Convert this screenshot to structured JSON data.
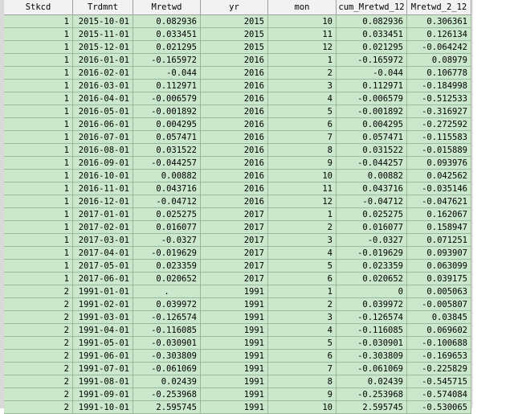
{
  "columns": [
    "Stkcd",
    "Trdmnt",
    "Mretwd",
    "yr",
    "mon",
    "cum_Mretwd_12",
    "Mretwd_2_12"
  ],
  "rows": [
    [
      "1",
      "2015-10-01",
      "0.082936",
      "2015",
      "10",
      "0.082936",
      "0.306361"
    ],
    [
      "1",
      "2015-11-01",
      "0.033451",
      "2015",
      "11",
      "0.033451",
      "0.126134"
    ],
    [
      "1",
      "2015-12-01",
      "0.021295",
      "2015",
      "12",
      "0.021295",
      "-0.064242"
    ],
    [
      "1",
      "2016-01-01",
      "-0.165972",
      "2016",
      "1",
      "-0.165972",
      "0.08979"
    ],
    [
      "1",
      "2016-02-01",
      "-0.044",
      "2016",
      "2",
      "-0.044",
      "0.106778"
    ],
    [
      "1",
      "2016-03-01",
      "0.112971",
      "2016",
      "3",
      "0.112971",
      "-0.184998"
    ],
    [
      "1",
      "2016-04-01",
      "-0.006579",
      "2016",
      "4",
      "-0.006579",
      "-0.512533"
    ],
    [
      "1",
      "2016-05-01",
      "-0.001892",
      "2016",
      "5",
      "-0.001892",
      "-0.316927"
    ],
    [
      "1",
      "2016-06-01",
      "0.004295",
      "2016",
      "6",
      "0.004295",
      "-0.272592"
    ],
    [
      "1",
      "2016-07-01",
      "0.057471",
      "2016",
      "7",
      "0.057471",
      "-0.115583"
    ],
    [
      "1",
      "2016-08-01",
      "0.031522",
      "2016",
      "8",
      "0.031522",
      "-0.015889"
    ],
    [
      "1",
      "2016-09-01",
      "-0.044257",
      "2016",
      "9",
      "-0.044257",
      "0.093976"
    ],
    [
      "1",
      "2016-10-01",
      "0.00882",
      "2016",
      "10",
      "0.00882",
      "0.042562"
    ],
    [
      "1",
      "2016-11-01",
      "0.043716",
      "2016",
      "11",
      "0.043716",
      "-0.035146"
    ],
    [
      "1",
      "2016-12-01",
      "-0.04712",
      "2016",
      "12",
      "-0.04712",
      "-0.047621"
    ],
    [
      "1",
      "2017-01-01",
      "0.025275",
      "2017",
      "1",
      "0.025275",
      "0.162067"
    ],
    [
      "1",
      "2017-02-01",
      "0.016077",
      "2017",
      "2",
      "0.016077",
      "0.158947"
    ],
    [
      "1",
      "2017-03-01",
      "-0.0327",
      "2017",
      "3",
      "-0.0327",
      "0.071251"
    ],
    [
      "1",
      "2017-04-01",
      "-0.019629",
      "2017",
      "4",
      "-0.019629",
      "0.093907"
    ],
    [
      "1",
      "2017-05-01",
      "0.023359",
      "2017",
      "5",
      "0.023359",
      "0.063099"
    ],
    [
      "1",
      "2017-06-01",
      "0.020652",
      "2017",
      "6",
      "0.020652",
      "0.039175"
    ],
    [
      "2",
      "1991-01-01",
      ".",
      "1991",
      "1",
      "0",
      "0.005063"
    ],
    [
      "2",
      "1991-02-01",
      "0.039972",
      "1991",
      "2",
      "0.039972",
      "-0.005807"
    ],
    [
      "2",
      "1991-03-01",
      "-0.126574",
      "1991",
      "3",
      "-0.126574",
      "0.03845"
    ],
    [
      "2",
      "1991-04-01",
      "-0.116085",
      "1991",
      "4",
      "-0.116085",
      "0.069602"
    ],
    [
      "2",
      "1991-05-01",
      "-0.030901",
      "1991",
      "5",
      "-0.030901",
      "-0.100688"
    ],
    [
      "2",
      "1991-06-01",
      "-0.303809",
      "1991",
      "6",
      "-0.303809",
      "-0.169653"
    ],
    [
      "2",
      "1991-07-01",
      "-0.061069",
      "1991",
      "7",
      "-0.061069",
      "-0.225829"
    ],
    [
      "2",
      "1991-08-01",
      "0.02439",
      "1991",
      "8",
      "0.02439",
      "-0.545715"
    ],
    [
      "2",
      "1991-09-01",
      "-0.253968",
      "1991",
      "9",
      "-0.253968",
      "-0.574084"
    ],
    [
      "2",
      "1991-10-01",
      "2.595745",
      "1991",
      "10",
      "2.595745",
      "-0.530065"
    ]
  ],
  "colors": {
    "cell_bg": "#cbe8cc",
    "header_bg": "#f2f2f2"
  }
}
